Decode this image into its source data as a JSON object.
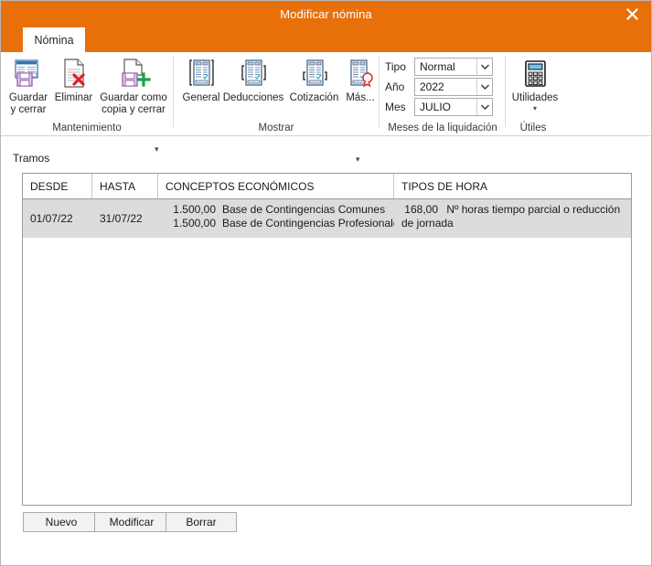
{
  "window": {
    "title": "Modificar nómina",
    "close_icon": "close-icon"
  },
  "tabs": [
    {
      "label": "Nómina",
      "active": true
    }
  ],
  "ribbon": {
    "groups": [
      {
        "name": "Mantenimiento",
        "label": "Mantenimiento",
        "buttons": [
          {
            "label": "Guardar\ny cerrar",
            "icon": "save-close-icon",
            "has_dropdown": false
          },
          {
            "label": "Eliminar",
            "icon": "delete-document-icon",
            "has_dropdown": false
          },
          {
            "label": "Guardar como\ncopia y cerrar",
            "icon": "save-as-copy-icon",
            "has_dropdown": true
          }
        ]
      },
      {
        "name": "Mostrar",
        "label": "Mostrar",
        "buttons": [
          {
            "label": "General",
            "icon": "document-general-icon",
            "has_dropdown": false
          },
          {
            "label": "Deducciones",
            "icon": "document-deductions-icon",
            "has_dropdown": false
          },
          {
            "label": "Cotización",
            "icon": "document-contribution-icon",
            "has_dropdown": false
          },
          {
            "label": "Más...",
            "icon": "document-more-icon",
            "has_dropdown": true
          }
        ]
      },
      {
        "name": "Meses de la liquidación",
        "label": "Meses de la liquidación",
        "fields": [
          {
            "label": "Tipo",
            "value": "Normal"
          },
          {
            "label": "Año",
            "value": "2022"
          },
          {
            "label": "Mes",
            "value": "JULIO"
          }
        ]
      },
      {
        "name": "Útiles",
        "label": "Útiles",
        "buttons": [
          {
            "label": "Utilidades",
            "icon": "calculator-icon",
            "has_dropdown": true
          }
        ]
      }
    ]
  },
  "main": {
    "section_label": "Tramos",
    "grid": {
      "columns": [
        "DESDE",
        "HASTA",
        "CONCEPTOS ECONÓMICOS",
        "TIPOS DE HORA"
      ],
      "rows": [
        {
          "selected": true,
          "desde": "01/07/22",
          "hasta": "31/07/22",
          "conceptos": [
            {
              "amount": "1.500,00",
              "text": "Base de Contingencias Comunes"
            },
            {
              "amount": "1.500,00",
              "text": "Base de Contingencias Profesionales"
            }
          ],
          "tipos": [
            {
              "amount": "168,00",
              "text": "Nº horas tiempo parcial o reducción de jornada"
            }
          ]
        }
      ]
    },
    "buttons": [
      {
        "label": "Nuevo"
      },
      {
        "label": "Modificar"
      },
      {
        "label": "Borrar"
      }
    ]
  },
  "colors": {
    "accent": "#e8700a",
    "selected_row": "#dcdcdc",
    "grid_border": "#9a9a9a"
  }
}
